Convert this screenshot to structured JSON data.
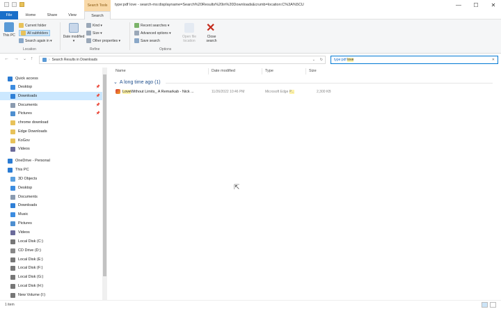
{
  "titlebar": {
    "context_tab": "Search Tools",
    "title": "type:pdf love - search-ms:displayname=Search%20Results%20in%20Downloads&crumb=location:C%3A%5CU",
    "minimize": "—",
    "maximize": "☐",
    "close": "✕"
  },
  "tabs": {
    "file": "File",
    "home": "Home",
    "share": "Share",
    "view": "View",
    "search": "Search"
  },
  "ribbon": {
    "location": {
      "this_pc": "This PC",
      "current_folder": "Current folder",
      "all_subfolders": "All subfolders",
      "search_again": "Search again in ▾",
      "label": "Location"
    },
    "refine": {
      "date_modified": "Date modified ▾",
      "kind": "Kind ▾",
      "size": "Size ▾",
      "other_properties": "Other properties ▾",
      "label": "Refine"
    },
    "options": {
      "recent_searches": "Recent searches ▾",
      "advanced_options": "Advanced options ▾",
      "save_search": "Save search",
      "open_file_location": "Open file location",
      "close_search": "Close search",
      "label": "Options"
    }
  },
  "address": {
    "back": "←",
    "forward": "→",
    "recent": "⌄",
    "up": "↑",
    "breadcrumb": "Search Results in Downloads",
    "dropdown": "⌄",
    "refresh": "↻",
    "search_query": "type:pdf",
    "search_query_hit": "love",
    "search_clear": "✕"
  },
  "navpane": {
    "items": [
      {
        "label": "Quick access",
        "icon": "star-icon",
        "color": "#2b7cd3"
      },
      {
        "label": "Desktop",
        "icon": "desktop-icon",
        "color": "#3c8ce0",
        "pin": "📌"
      },
      {
        "label": "Downloads",
        "icon": "download-icon",
        "color": "#2f7fd6",
        "pin": "📌"
      },
      {
        "label": "Documents",
        "icon": "documents-icon",
        "color": "#8a9bb0",
        "pin": "📌"
      },
      {
        "label": "Pictures",
        "icon": "pictures-icon",
        "color": "#4e8fd0",
        "pin": "📌"
      },
      {
        "label": "chrome download",
        "icon": "folder-icon",
        "color": "#e8c25a"
      },
      {
        "label": "Edge Downloads",
        "icon": "folder-icon",
        "color": "#e8c25a"
      },
      {
        "label": "KoGov",
        "icon": "folder-icon",
        "color": "#e8c25a"
      },
      {
        "label": "Videos",
        "icon": "videos-icon",
        "color": "#6b6b9b"
      },
      {
        "label": "OneDrive - Personal",
        "icon": "cloud-icon",
        "color": "#2b7cd3"
      },
      {
        "label": "This PC",
        "icon": "computer-icon",
        "color": "#2b7cd3"
      },
      {
        "label": "3D Objects",
        "icon": "3d-objects-icon",
        "color": "#5aa0e0"
      },
      {
        "label": "Desktop",
        "icon": "desktop-icon",
        "color": "#3c8ce0"
      },
      {
        "label": "Documents",
        "icon": "documents-icon",
        "color": "#8a9bb0"
      },
      {
        "label": "Downloads",
        "icon": "download-icon",
        "color": "#2f7fd6"
      },
      {
        "label": "Music",
        "icon": "music-icon",
        "color": "#3c8ce0"
      },
      {
        "label": "Pictures",
        "icon": "pictures-icon",
        "color": "#4e8fd0"
      },
      {
        "label": "Videos",
        "icon": "videos-icon",
        "color": "#6b6b9b"
      },
      {
        "label": "Local Disk (C:)",
        "icon": "drive-icon",
        "color": "#777777"
      },
      {
        "label": "CD Drive (D:)",
        "icon": "cd-drive-icon",
        "color": "#888888"
      },
      {
        "label": "Local Disk (E:)",
        "icon": "drive-icon",
        "color": "#777777"
      },
      {
        "label": "Local Disk (F:)",
        "icon": "drive-icon",
        "color": "#777777"
      },
      {
        "label": "Local Disk (G:)",
        "icon": "drive-icon",
        "color": "#777777"
      },
      {
        "label": "Local Disk (H:)",
        "icon": "drive-icon",
        "color": "#777777"
      },
      {
        "label": "New Volume (I:)",
        "icon": "drive-icon",
        "color": "#777777"
      }
    ]
  },
  "content": {
    "columns": [
      "Name",
      "Date modified",
      "Type",
      "Size"
    ],
    "group_label": "A long time ago (1)",
    "group_chevron": "⌄",
    "row": {
      "name_hit": "Love",
      "name_rest": " Without Limits_ A Remarkab - Nick ...",
      "date": "11/26/2022 10:46 PM",
      "type_prefix": "Microsoft Edge ",
      "type_hit": "P...",
      "size": "2,300 KB"
    }
  },
  "status": {
    "items": "1 item"
  }
}
